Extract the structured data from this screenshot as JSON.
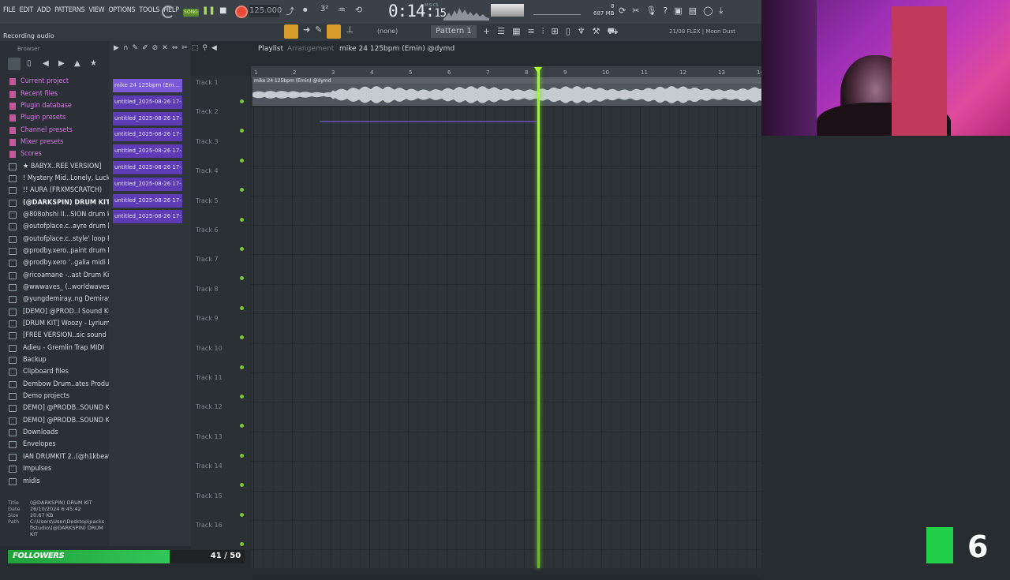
{
  "menu": [
    "FILE",
    "EDIT",
    "ADD",
    "PATTERNS",
    "VIEW",
    "OPTIONS",
    "TOOLS",
    "HELP"
  ],
  "transport": {
    "song_label": "SONG",
    "tempo": "125.000",
    "time": "0:14",
    "time_small": "15",
    "time_unit": "M:S:CS",
    "memory": "687 MB",
    "cpu": "8"
  },
  "hint": "Recording audio",
  "toolbar2": {
    "none_label": "(none)",
    "pattern": "Pattern 1",
    "flex": "21/08 FLEX | Moon Dust"
  },
  "browser": {
    "label": "Browser",
    "items": [
      {
        "label": "Current project",
        "kind": "special"
      },
      {
        "label": "Recent files",
        "kind": "special"
      },
      {
        "label": "Plugin database",
        "kind": "special"
      },
      {
        "label": "Plugin presets",
        "kind": "special"
      },
      {
        "label": "Channel presets",
        "kind": "special"
      },
      {
        "label": "Mixer presets",
        "kind": "special"
      },
      {
        "label": "Scores",
        "kind": "special"
      },
      {
        "label": "★ BABYX..REE VERSION]",
        "kind": "folder"
      },
      {
        "label": "! Mystery Mid..Lonely, Lucki)",
        "kind": "folder"
      },
      {
        "label": "!! AURA (FRXMSCRATCH)",
        "kind": "folder"
      },
      {
        "label": "(@DARKSPIN) DRUM KIT",
        "kind": "folder bold"
      },
      {
        "label": "@808ohshi II...SION drum kit",
        "kind": "folder"
      },
      {
        "label": "@outofplace.c..ayre drum kit",
        "kind": "folder"
      },
      {
        "label": "@outofplace.c..style' loop kit",
        "kind": "folder"
      },
      {
        "label": "@prodby.xero..paint drum kit",
        "kind": "folder"
      },
      {
        "label": "@prodby.xero '..galia midi kit",
        "kind": "folder"
      },
      {
        "label": "@ricoamane -..ast Drum Kit",
        "kind": "folder"
      },
      {
        "label": "@wwwaves_ (..worldwaves)",
        "kind": "folder"
      },
      {
        "label": "@yungdemiray..ng Demirayy)",
        "kind": "folder"
      },
      {
        "label": "[DEMO] @PROD..l Sound Kit",
        "kind": "folder"
      },
      {
        "label": "[DRUM KIT] Woozy - Lyrium",
        "kind": "folder"
      },
      {
        "label": "[FREE VERSION..sic sound kit",
        "kind": "folder"
      },
      {
        "label": "Adieu - Gremlin Trap MIDI",
        "kind": "folder"
      },
      {
        "label": "Backup",
        "kind": "folder"
      },
      {
        "label": "Clipboard files",
        "kind": "folder"
      },
      {
        "label": "Dembow Drum..ates Produce",
        "kind": "folder"
      },
      {
        "label": "Demo projects",
        "kind": "folder"
      },
      {
        "label": "DEMO] @PRODB..SOUND KIT",
        "kind": "folder"
      },
      {
        "label": "DEMO] @PRODB..SOUND KIT",
        "kind": "folder"
      },
      {
        "label": "Downloads",
        "kind": "folder"
      },
      {
        "label": "Envelopes",
        "kind": "folder"
      },
      {
        "label": "IAN DRUMKIT 2..(@h1kbeats)",
        "kind": "folder"
      },
      {
        "label": "Impulses",
        "kind": "folder"
      },
      {
        "label": "midis",
        "kind": "folder"
      }
    ]
  },
  "info": {
    "title_k": "Title",
    "title_v": "(@DARKSPIN) DRUM KIT",
    "date_k": "Date",
    "date_v": "26/10/2024 6:45:42",
    "size_k": "Size",
    "size_v": "20.67 KB",
    "path_k": "Path",
    "path_v": "C:\\Users\\User\\Desktop\\packs flstudio\\(@DARKSPIN) DRUM KIT"
  },
  "patterns": [
    "mike 24 125bpm (Em...",
    "untitled_2025-08-26 17-...",
    "untitled_2025-08-26 17-...",
    "untitled_2025-08-26 17-...",
    "untitled_2025-08-26 17-...",
    "untitled_2025-08-26 17-...",
    "untitled_2025-08-26 17-...",
    "untitled_2025-08-26 17-...",
    "untitled_2025-08-26 17-..."
  ],
  "playlist": {
    "title": "Playlist",
    "section": "Arrangement",
    "song": "mike 24 125bpm (Emin) @dymd",
    "clip_title": "mike 24 125bpm (Emin) @dymd",
    "tracks": [
      "Track 1",
      "Track 2",
      "Track 3",
      "Track 4",
      "Track 5",
      "Track 6",
      "Track 7",
      "Track 8",
      "Track 9",
      "Track 10",
      "Track 11",
      "Track 12",
      "Track 13",
      "Track 14",
      "Track 15",
      "Track 16"
    ],
    "bars": [
      "1",
      "2",
      "3",
      "4",
      "5",
      "6",
      "7",
      "8",
      "9",
      "10",
      "11",
      "12",
      "13",
      "14"
    ]
  },
  "followers": {
    "label": "FOLLOWERS",
    "count": "41 / 50",
    "progress": 0.82
  },
  "logo": {
    "text": "6",
    "colors": {
      "green": "#22d04a"
    }
  },
  "colors": {
    "accent": "#a6ff2c",
    "pattern": "#5c3bb5",
    "special": "#d779e6"
  }
}
